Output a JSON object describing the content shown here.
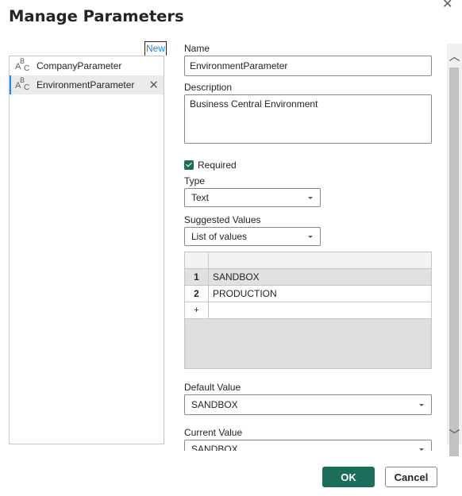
{
  "dialog": {
    "title": "Manage Parameters",
    "close_glyph": "✕"
  },
  "list": {
    "new_label": "New",
    "items": [
      {
        "label": "CompanyParameter",
        "icon": "abc-text-type-icon"
      },
      {
        "label": "EnvironmentParameter",
        "icon": "abc-text-type-icon",
        "selected": true
      }
    ],
    "remove_glyph": "✕"
  },
  "form": {
    "name_label": "Name",
    "name_value": "EnvironmentParameter",
    "description_label": "Description",
    "description_value": "Business Central Environment",
    "required_label": "Required",
    "required_checked": true,
    "type_label": "Type",
    "type_value": "Text",
    "suggested_label": "Suggested Values",
    "suggested_value": "List of values",
    "values": [
      {
        "num": "1",
        "value": "SANDBOX"
      },
      {
        "num": "2",
        "value": "PRODUCTION"
      }
    ],
    "add_row_glyph": "+",
    "default_label": "Default Value",
    "default_value": "SANDBOX",
    "current_label": "Current Value",
    "current_value": "SANDBOX"
  },
  "scroll": {
    "up_glyph": "︿",
    "down_glyph": "﹀"
  },
  "buttons": {
    "ok": "OK",
    "cancel": "Cancel"
  },
  "colors": {
    "accent": "#1c6e5b",
    "selection_bar": "#118dff",
    "link": "#118dff"
  }
}
